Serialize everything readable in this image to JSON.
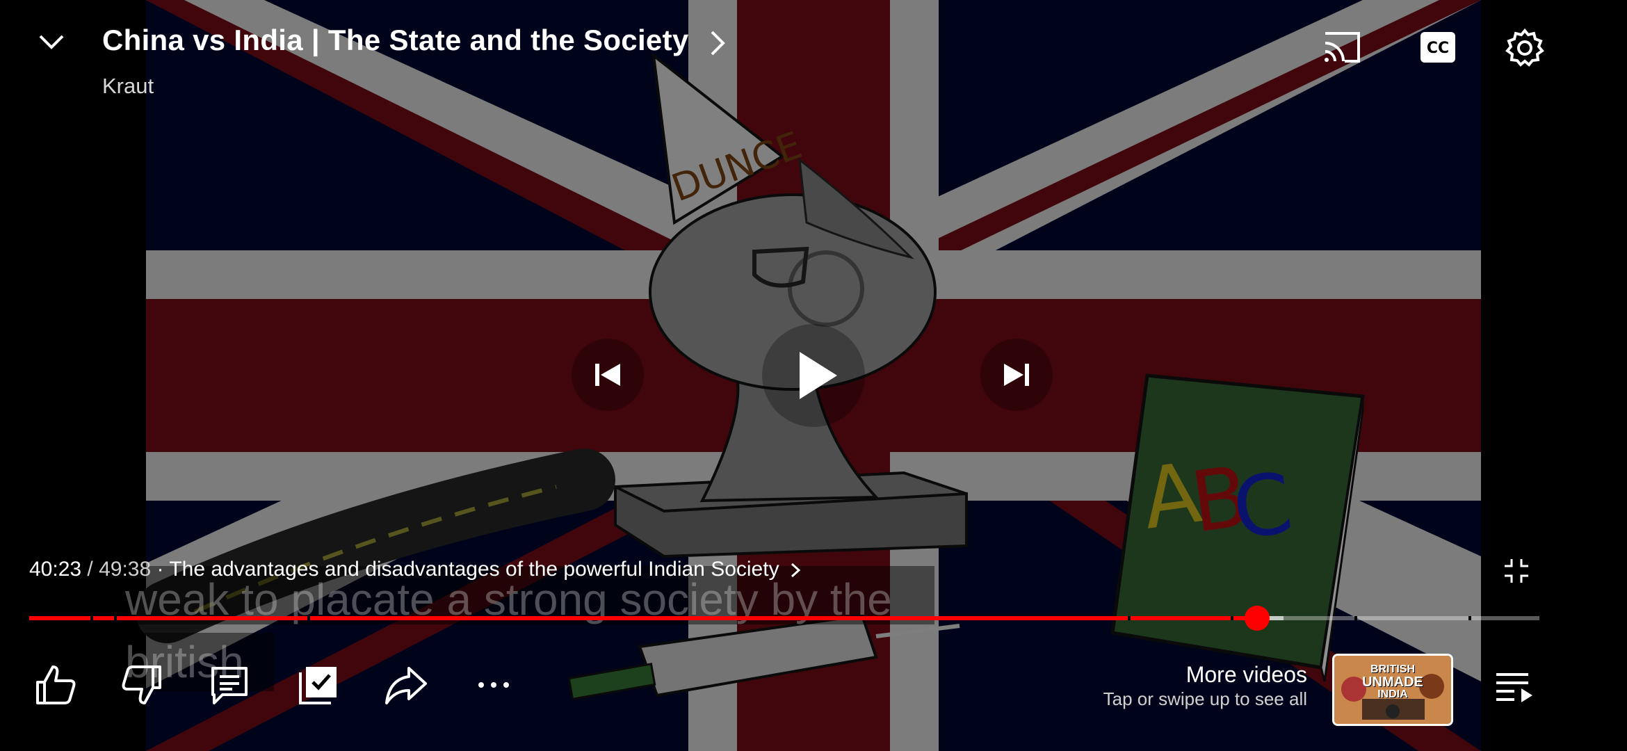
{
  "video": {
    "title": "China vs India | The State and the Society",
    "channel": "Kraut",
    "book_letters": [
      "A",
      "B",
      "C"
    ],
    "hat_text": "DUNCE"
  },
  "subtitles": {
    "line1": "weak to placate a strong society by the",
    "line2": "british"
  },
  "player": {
    "current_time": "40:23",
    "duration": "/ 49:38",
    "separator": "·",
    "chapter": "The advantages and disadvantages of the powerful Indian Society",
    "progress_fraction": 0.813
  },
  "more_videos": {
    "title": "More videos",
    "subtitle": "Tap or swipe up to see all",
    "thumbnail_text_1": "BRITISH",
    "thumbnail_text_2": "UNMADE",
    "thumbnail_text_3": "INDIA"
  },
  "icons": {
    "collapse": "chevron-down-icon",
    "cast": "cast-icon",
    "captions": "cc-icon",
    "settings": "gear-icon",
    "previous": "skip-previous-icon",
    "play": "play-icon",
    "next": "skip-next-icon",
    "fullscreen_exit": "fullscreen-exit-icon",
    "like": "thumbs-up-icon",
    "dislike": "thumbs-down-icon",
    "comments": "comments-icon",
    "save": "save-to-playlist-icon",
    "share": "share-icon",
    "more": "more-horizontal-icon",
    "queue": "playlist-play-icon"
  },
  "colors": {
    "progress": "#ff0000",
    "flag_blue": "#00072a",
    "flag_red": "#6a0a14",
    "flag_white": "#d0d0d0"
  }
}
